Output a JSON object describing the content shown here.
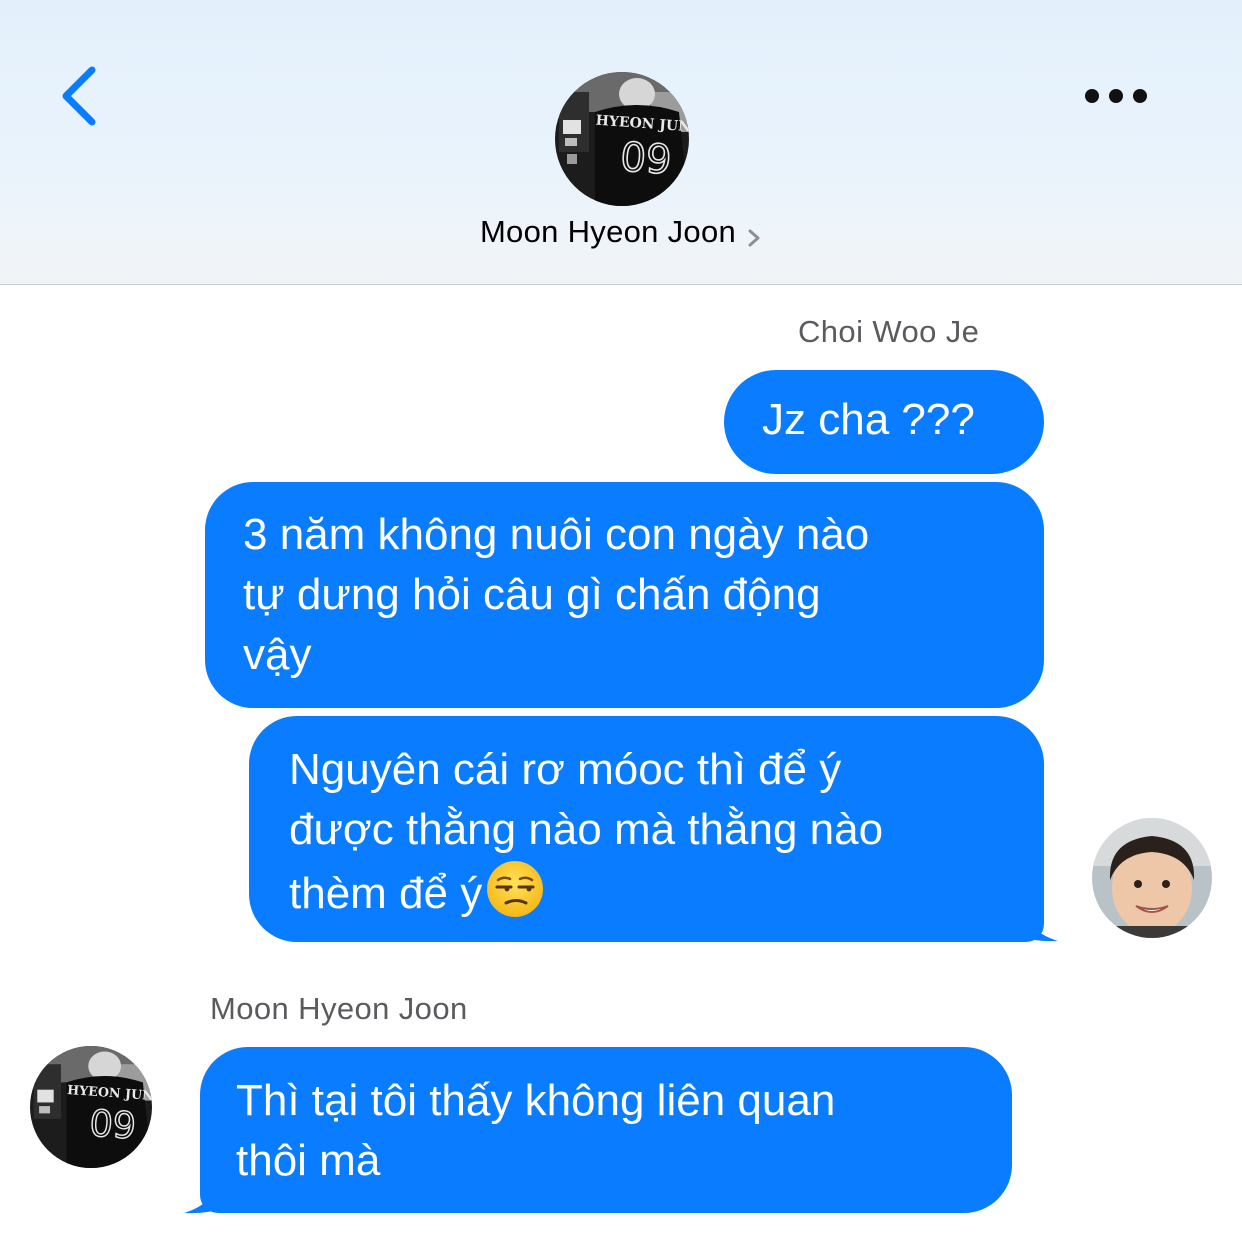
{
  "header": {
    "contact_name": "Moon Hyeon Joon",
    "back_icon": "chevron-left-icon",
    "more_icon": "ellipsis-icon",
    "accent_color": "#0a7cff"
  },
  "jersey": {
    "name": "HYEON JUN",
    "number": "09"
  },
  "conversation": {
    "sent_sender": "Choi Woo Je",
    "sent_messages": [
      {
        "text": "Jz cha ???"
      },
      {
        "text": "3 năm không nuôi con ngày nào\ntự dưng hỏi câu gì chấn động\nvậy"
      },
      {
        "text": "Nguyên cái rơ móoc thì để ý\nđược thằng nào mà thằng nào\nthèm để ý",
        "emoji": "unamused-face-emoji"
      }
    ],
    "received_sender": "Moon Hyeon Joon",
    "received_messages": [
      {
        "text": "Thì tại tôi thấy không liên quan\nthôi mà"
      }
    ]
  }
}
